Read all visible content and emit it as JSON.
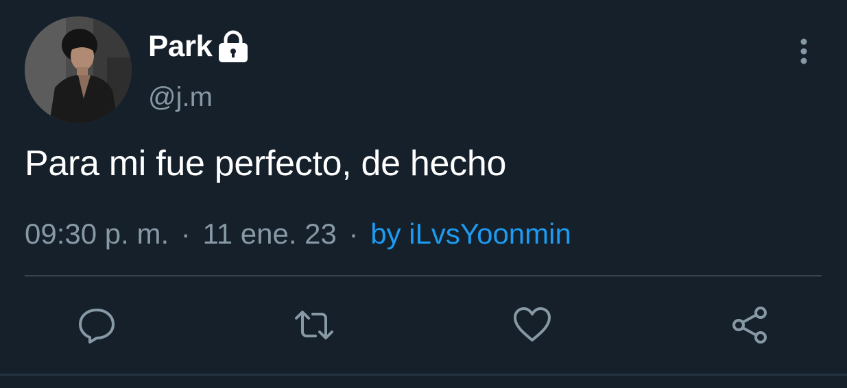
{
  "colors": {
    "background": "#15202b",
    "text_primary": "#ffffff",
    "text_secondary": "#8899a6",
    "link": "#1d9bf0",
    "divider": "#38444d"
  },
  "author": {
    "display_name": "Park",
    "handle": "@j.m",
    "protected_icon": "lock-icon",
    "avatar": "profile-photo"
  },
  "menu": {
    "icon": "more-vertical-icon"
  },
  "tweet": {
    "text": "Para mi fue perfecto, de hecho",
    "time": "09:30 p. m.",
    "separator": "·",
    "date": "11 ene. 23",
    "separator2": "·",
    "source": "by iLvsYoonmin"
  },
  "actions": [
    {
      "name": "reply",
      "icon": "reply-icon"
    },
    {
      "name": "retweet",
      "icon": "retweet-icon"
    },
    {
      "name": "like",
      "icon": "heart-icon"
    },
    {
      "name": "share",
      "icon": "share-icon"
    }
  ]
}
